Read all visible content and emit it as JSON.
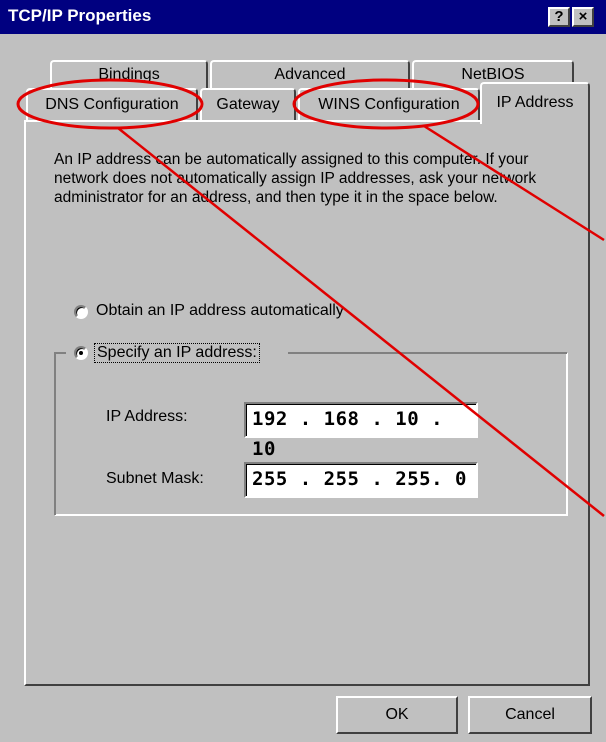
{
  "window": {
    "title": "TCP/IP Properties",
    "help_button": "?",
    "close_button": "×"
  },
  "tabs_back": [
    "Bindings",
    "Advanced",
    "NetBIOS"
  ],
  "tabs_front": [
    "DNS Configuration",
    "Gateway",
    "WINS Configuration",
    "IP Address"
  ],
  "selected_tab": "IP Address",
  "description": "An IP address can be automatically assigned to this computer. If your network does not automatically assign IP addresses, ask your network administrator for an address, and then type it in the space below.",
  "options": {
    "obtain_label": "Obtain an IP address automatically",
    "specify_label": "Specify an IP address:",
    "selected": "specify"
  },
  "fields": {
    "ip_label": "IP Address:",
    "ip_value": "192 . 168 . 10 . 10",
    "subnet_label": "Subnet Mask:",
    "subnet_value": "255 . 255 . 255.  0"
  },
  "buttons": {
    "ok": "OK",
    "cancel": "Cancel"
  },
  "annotation_color": "#e00000"
}
